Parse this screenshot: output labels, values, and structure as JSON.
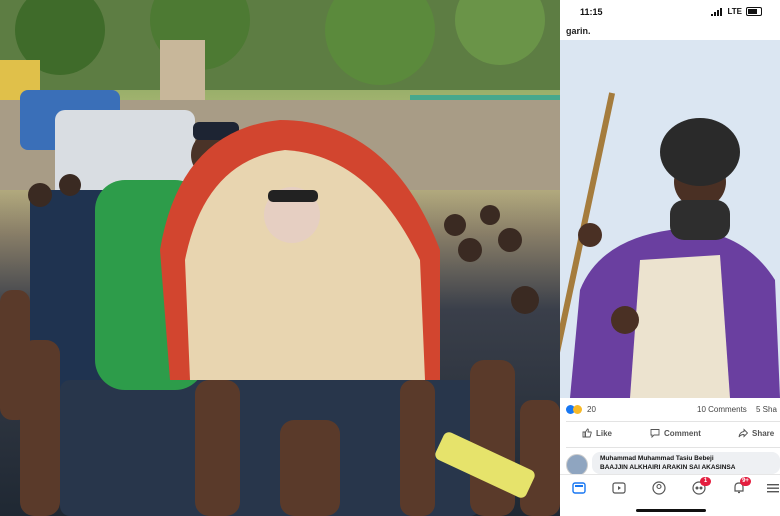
{
  "status_bar": {
    "time": "11:15",
    "network": "LTE"
  },
  "post": {
    "text_fragment": "garin.",
    "reactions": {
      "count": "20",
      "icons": [
        "like-icon",
        "wow-icon"
      ]
    },
    "comments": "10 Comments",
    "shares": "5 Sha"
  },
  "actions": {
    "like": "Like",
    "comment": "Comment",
    "share": "Share"
  },
  "comment_preview": {
    "author": "Muhammad Muhammad Tasiu Bebeji",
    "text": "BAAJJIN ALKHAIRI ARAKIN SAI AKASINSA"
  },
  "bottom_nav": {
    "items": [
      "home-icon",
      "video-icon",
      "profile-icon",
      "groups-icon",
      "notifications-icon",
      "menu-icon"
    ],
    "groups_badge": "1",
    "notifications_badge": "9+"
  },
  "colors": {
    "brand_blue": "#1877f2",
    "badge_red": "#e41e3f"
  }
}
